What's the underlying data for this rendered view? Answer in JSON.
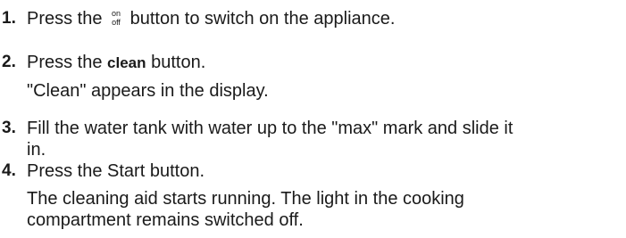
{
  "steps": [
    {
      "number": "1.",
      "before": "Press the",
      "icon": "on-off-button-icon",
      "icon_top": "on",
      "icon_bottom": "off",
      "after": "button to switch on the appliance."
    },
    {
      "number": "2.",
      "before": "Press the",
      "bold": "clean",
      "after": "button.",
      "result": "\"Clean\" appears in the display."
    },
    {
      "number": "3.",
      "line1": "Fill the water tank with water up to the \"max\" mark and slide it",
      "line2": "in."
    },
    {
      "number": "4.",
      "text": "Press the Start button.",
      "result_line1": "The cleaning aid starts running. The light in the cooking",
      "result_line2": "compartment remains switched off."
    }
  ]
}
